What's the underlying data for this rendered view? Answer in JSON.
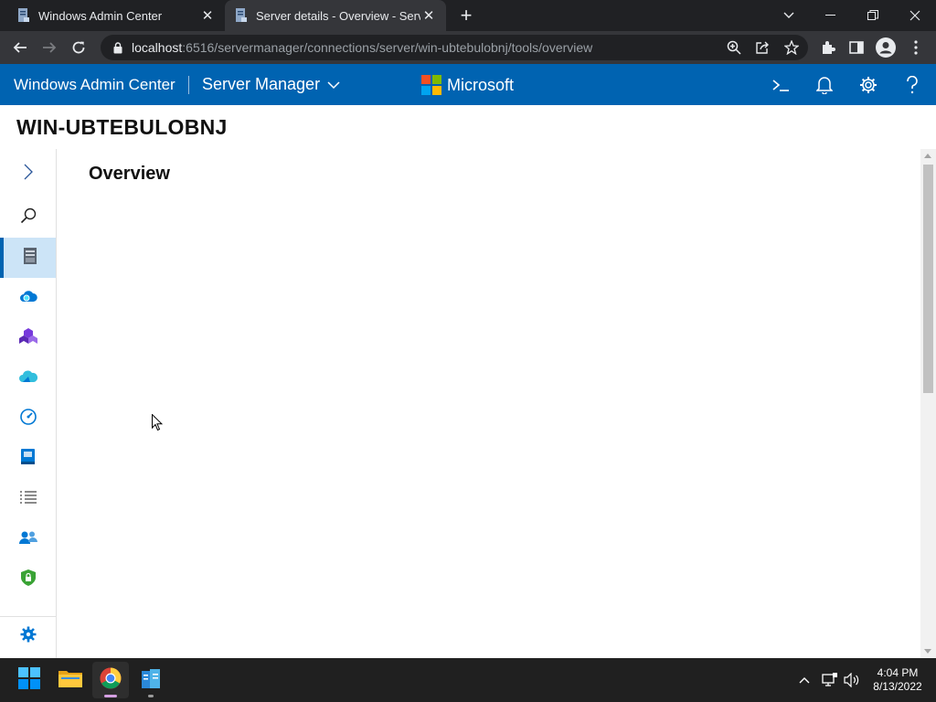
{
  "browser": {
    "tabs": [
      {
        "title": "Windows Admin Center",
        "active": false
      },
      {
        "title": "Server details - Overview - Server Manager",
        "active": true
      }
    ],
    "url_host": "localhost",
    "url_rest": ":6516/servermanager/connections/server/win-ubtebulobnj/tools/overview"
  },
  "app": {
    "brand": "Windows Admin Center",
    "product": "Server Manager",
    "microsoft": "Microsoft",
    "accent": "#0063b1"
  },
  "server": {
    "name": "WIN-UBTEBULOBNJ"
  },
  "content": {
    "title": "Overview"
  },
  "sidebar": {
    "items": [
      {
        "icon": "chevron-right-icon",
        "active": false
      },
      {
        "icon": "search-icon",
        "active": false
      },
      {
        "icon": "server-icon",
        "active": true
      },
      {
        "icon": "cloud-icon",
        "active": false
      },
      {
        "icon": "cubes-icon",
        "active": false
      },
      {
        "icon": "azure-cloud-icon",
        "active": false
      },
      {
        "icon": "gauge-icon",
        "active": false
      },
      {
        "icon": "book-icon",
        "active": false
      },
      {
        "icon": "list-icon",
        "active": false
      },
      {
        "icon": "users-icon",
        "active": false
      },
      {
        "icon": "shield-lock-icon",
        "active": false
      },
      {
        "icon": "gear-icon",
        "active": false
      }
    ]
  },
  "taskbar": {
    "time": "4:04 PM",
    "date": "8/13/2022"
  }
}
